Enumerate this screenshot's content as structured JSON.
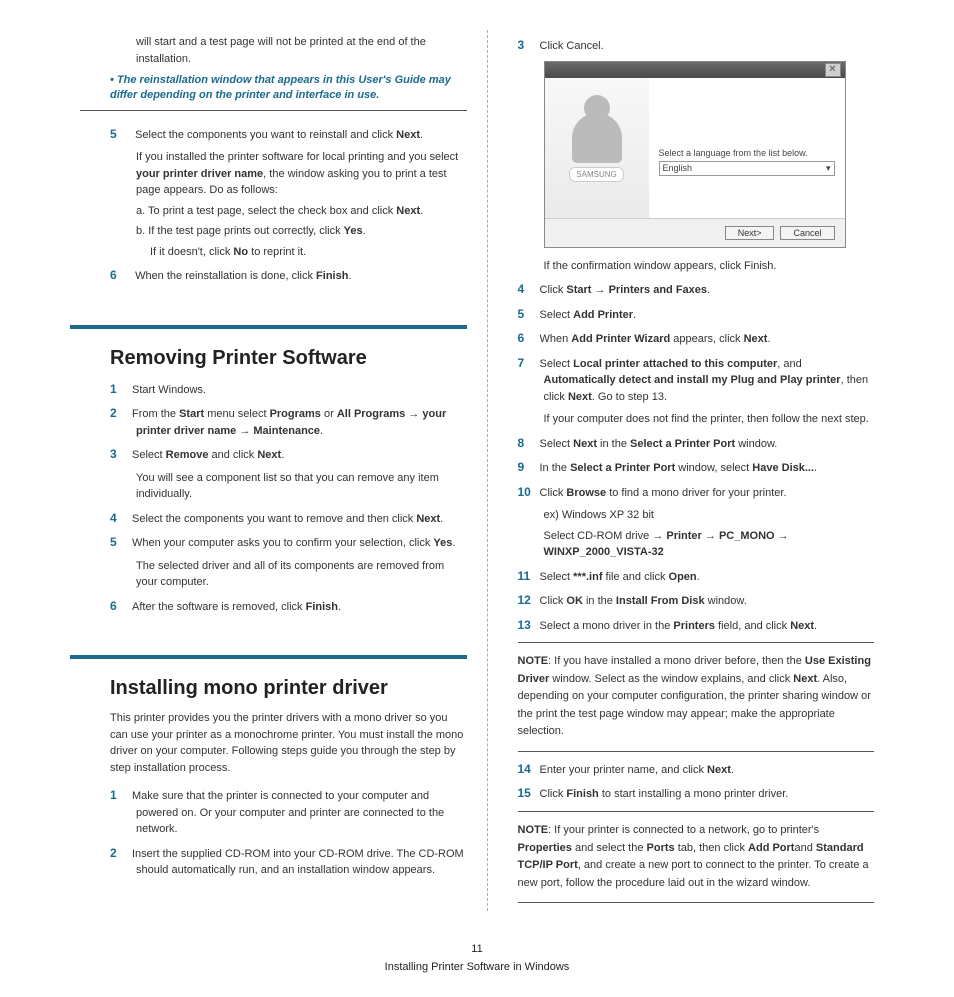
{
  "left": {
    "cont_text": "will start and a test page will not be printed at the end of the installation.",
    "note_bullet": "The reinstallation window that appears in this User's Guide may differ depending on the printer and interface in use.",
    "step5": {
      "n": "5",
      "text": "Select the components you want to reinstall and click ",
      "b1": "Next",
      "after": "."
    },
    "step5_sub1_a": "If you installed the printer software for local printing and you select ",
    "step5_sub1_b": "your printer driver name",
    "step5_sub1_c": ", the window asking you to print a test page appears. Do as follows:",
    "step5_a_a": "a. To print a test page, select the check box and click ",
    "step5_a_b": "Next",
    "step5_a_c": ".",
    "step5_b_a": "b. If the test page prints out correctly, click ",
    "step5_b_b": "Yes",
    "step5_b_c": ".",
    "step5_b2_a": "If it doesn't, click ",
    "step5_b2_b": "No",
    "step5_b2_c": " to reprint it.",
    "step6": {
      "n": "6",
      "a": "When the reinstallation is done, click ",
      "b": "Finish",
      "c": "."
    },
    "h_remove": "Removing Printer Software",
    "r1": {
      "n": "1",
      "t": "Start Windows."
    },
    "r2": {
      "n": "2",
      "a": "From the ",
      "b": "Start",
      "c": " menu select ",
      "d": "Programs",
      "e": " or ",
      "f": "All Programs",
      "g": " → ",
      "h": "your printer driver name",
      "i": " → ",
      "j": "Maintenance",
      "k": "."
    },
    "r3": {
      "n": "3",
      "a": "Select ",
      "b": "Remove",
      "c": " and click ",
      "d": "Next",
      "e": "."
    },
    "r3_sub": "You will see a component list so that you can remove any item individually.",
    "r4": {
      "n": "4",
      "a": "Select the components you want to remove and then click ",
      "b": "Next",
      "c": "."
    },
    "r5": {
      "n": "5",
      "a": "When your computer asks you to confirm your selection, click ",
      "b": "Yes",
      "c": "."
    },
    "r5_sub": "The selected driver and all of its components are removed from your computer.",
    "r6": {
      "n": "6",
      "a": "After the software is removed, click ",
      "b": "Finish",
      "c": "."
    },
    "h_mono": "Installing mono printer driver",
    "mono_intro": "This printer provides you the printer drivers with a mono driver so you can use your printer as a monochrome printer. You must install the mono driver on your computer. Following steps guide you through the step by step installation process.",
    "m1": {
      "n": "1",
      "t": "Make sure that the printer is connected to your computer and powered on. Or your computer and printer are connected to the network."
    },
    "m2": {
      "n": "2",
      "t": "Insert the supplied CD-ROM into your CD-ROM drive. The CD-ROM should automatically run, and an installation window appears."
    }
  },
  "right": {
    "s3": {
      "n": "3",
      "t": "Click Cancel."
    },
    "ss": {
      "label": "Select a language from the list below.",
      "value": "English",
      "next": "Next>",
      "cancel": "Cancel"
    },
    "s3_sub": "If the confirmation window appears, click Finish.",
    "s4": {
      "n": "4",
      "a": "Click ",
      "b": "Start",
      "c": " → ",
      "d": "Printers and Faxes",
      "e": "."
    },
    "s5": {
      "n": "5",
      "a": "Select ",
      "b": "Add Printer",
      "c": "."
    },
    "s6": {
      "n": "6",
      "a": "When ",
      "b": "Add Printer Wizard",
      "c": " appears, click ",
      "d": "Next",
      "e": "."
    },
    "s7": {
      "n": "7",
      "a": "Select ",
      "b": "Local printer attached to this computer",
      "c": ", and ",
      "d": "Automatically detect and install my Plug and Play printer",
      "e": ", then click ",
      "f": "Next",
      "g": ". Go to step 13."
    },
    "s7_sub": "If your computer does not find the printer, then follow the next step.",
    "s8": {
      "n": "8",
      "a": "Select ",
      "b": "Next",
      "c": " in the ",
      "d": "Select a Printer Port",
      "e": " window."
    },
    "s9": {
      "n": "9",
      "a": "In the ",
      "b": "Select a Printer Port",
      "c": " window, select ",
      "d": "Have Disk...",
      "e": "."
    },
    "s10": {
      "n": "10",
      "a": "Click ",
      "b": "Browse",
      "c": " to find a mono driver for your printer."
    },
    "s10_sub1": "ex) Windows XP 32 bit",
    "s10_sub2_a": "Select CD-ROM drive → ",
    "s10_sub2_b": "Printer",
    "s10_sub2_c": " → ",
    "s10_sub2_d": "PC_MONO",
    "s10_sub2_e": " → ",
    "s10_sub2_f": "WINXP_2000_VISTA-32",
    "s11": {
      "n": "11",
      "a": "Select ",
      "b": "***.inf",
      "c": " file and click ",
      "d": "Open",
      "e": "."
    },
    "s12": {
      "n": "12",
      "a": "Click ",
      "b": "OK",
      "c": " in the ",
      "d": "Install From Disk",
      "e": " window."
    },
    "s13": {
      "n": "13",
      "a": "Select a mono driver in the ",
      "b": "Printers",
      "c": " field, and click ",
      "d": "Next",
      "e": "."
    },
    "note1_a": "NOTE",
    "note1_b": ": If you have installed a mono driver before, then the ",
    "note1_c": "Use Existing Driver",
    "note1_d": " window. Select as the window explains, and click ",
    "note1_e": "Next",
    "note1_f": ". Also, depending on your computer configuration, the printer sharing window or the print the test page window may appear; make the appropriate selection.",
    "s14": {
      "n": "14",
      "a": "Enter your printer name, and click ",
      "b": "Next",
      "c": "."
    },
    "s15": {
      "n": "15",
      "a": "Click ",
      "b": "Finish",
      "c": " to start installing a mono printer driver."
    },
    "note2_a": "NOTE",
    "note2_b": ": If your printer is connected to a network, go to printer's ",
    "note2_c": "Properties",
    "note2_d": " and select the ",
    "note2_e": "Ports",
    "note2_f": " tab, then click ",
    "note2_g": "Add Port",
    "note2_h": "and ",
    "note2_i": "Standard TCP/IP Port",
    "note2_j": ", and create a new port to connect to the printer. To create a new port, follow the procedure laid out in the wizard window."
  },
  "footer": {
    "page": "11",
    "caption": "Installing Printer Software in Windows"
  }
}
